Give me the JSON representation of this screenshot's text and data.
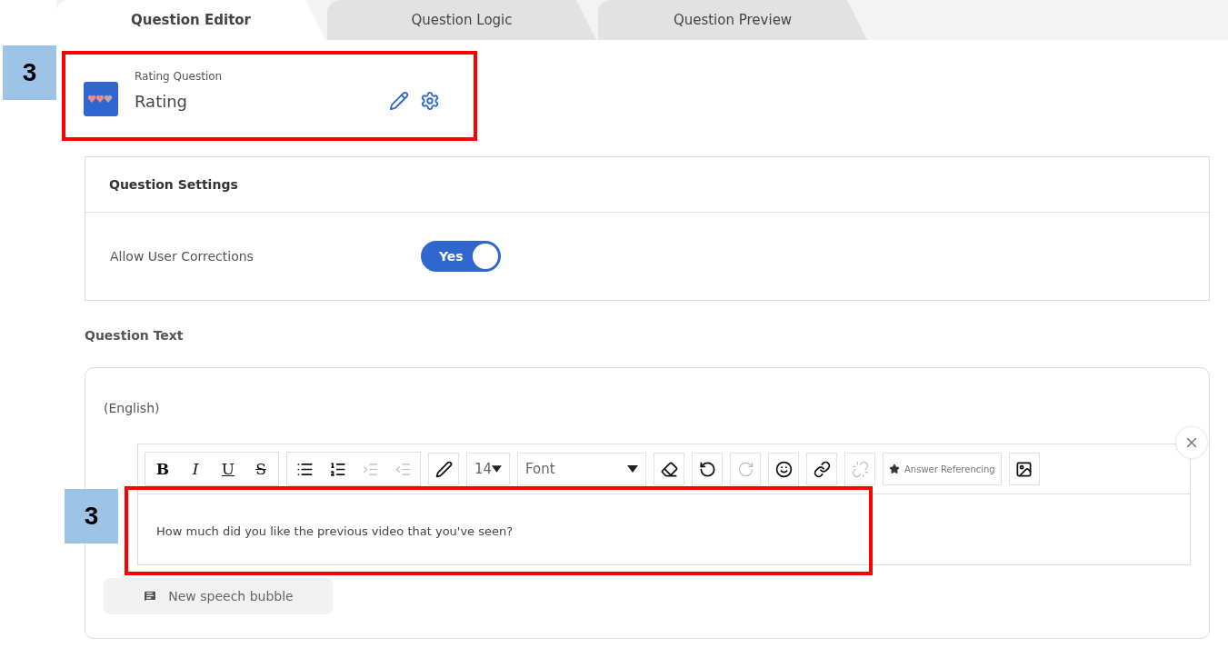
{
  "tabs": [
    {
      "label": "Question Editor",
      "selected": true
    },
    {
      "label": "Question Logic",
      "selected": false
    },
    {
      "label": "Question Preview",
      "selected": false
    }
  ],
  "question": {
    "type_label": "Rating Question",
    "name": "Rating"
  },
  "settings": {
    "title": "Question Settings",
    "rows": [
      {
        "label": "Allow User Corrections",
        "on": true,
        "value": "Yes"
      }
    ]
  },
  "question_text": {
    "label": "Question Text",
    "language": "(English)",
    "toolbar": [
      {
        "kind": "group",
        "items": [
          {
            "kind": "bold",
            "text": "B"
          },
          {
            "kind": "italic",
            "text": "I"
          },
          {
            "kind": "underline",
            "text": "U"
          },
          {
            "kind": "strike",
            "text": "S"
          }
        ]
      },
      {
        "kind": "group",
        "items": [
          {
            "kind": "bullets",
            "disabled": false
          },
          {
            "kind": "numbers",
            "disabled": false
          },
          {
            "kind": "indent",
            "disabled": true
          },
          {
            "kind": "outdent",
            "disabled": true
          }
        ]
      },
      {
        "kind": "pen",
        "disabled": false
      },
      {
        "kind": "size",
        "text": "14"
      },
      {
        "kind": "font",
        "text": "Font"
      },
      {
        "kind": "eraser",
        "disabled": false
      },
      {
        "kind": "undo",
        "disabled": false
      },
      {
        "kind": "redo",
        "disabled": true
      },
      {
        "kind": "emoji",
        "disabled": false
      },
      {
        "kind": "link",
        "disabled": false
      },
      {
        "kind": "unlink",
        "disabled": true
      },
      {
        "kind": "answer",
        "text": "Answer Referencing"
      },
      {
        "kind": "image",
        "disabled": false
      }
    ],
    "content": "How much did you like the previous video that you've seen?",
    "bubble_button": "New speech bubble"
  },
  "annotations": [
    {
      "label": "3"
    },
    {
      "label": "3"
    }
  ]
}
